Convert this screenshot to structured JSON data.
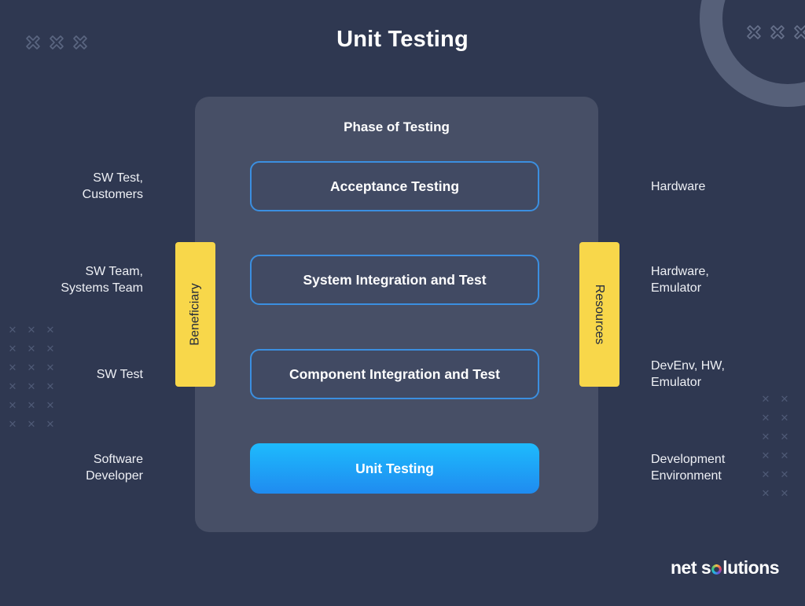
{
  "title": "Unit Testing",
  "panel": {
    "title": "Phase of Testing",
    "phases": [
      {
        "label": "Acceptance Testing",
        "highlighted": false
      },
      {
        "label": "System Integration and Test",
        "highlighted": false
      },
      {
        "label": "Component Integration and Test",
        "highlighted": false
      },
      {
        "label": "Unit Testing",
        "highlighted": true
      }
    ]
  },
  "side_tags": {
    "left": "Beneficiary",
    "right": "Resources"
  },
  "beneficiaries": [
    {
      "line1": "SW Test,",
      "line2": "Customers"
    },
    {
      "line1": "SW Team,",
      "line2": "Systems Team"
    },
    {
      "line1": "SW Test",
      "line2": ""
    },
    {
      "line1": "Software",
      "line2": "Developer"
    }
  ],
  "resources": [
    {
      "line1": "Hardware",
      "line2": ""
    },
    {
      "line1": "Hardware,",
      "line2": "Emulator"
    },
    {
      "line1": "DevEnv, HW,",
      "line2": "Emulator"
    },
    {
      "line1": "Development",
      "line2": "Environment"
    }
  ],
  "logo": {
    "part1": "net s",
    "part2": "lutions"
  },
  "colors": {
    "background": "#2f3851",
    "panel": "#474f66",
    "phase_border": "#3b8fe0",
    "highlight_top": "#1ebbfd",
    "highlight_bottom": "#1f8bf0",
    "tag_yellow": "#f8d74a"
  }
}
